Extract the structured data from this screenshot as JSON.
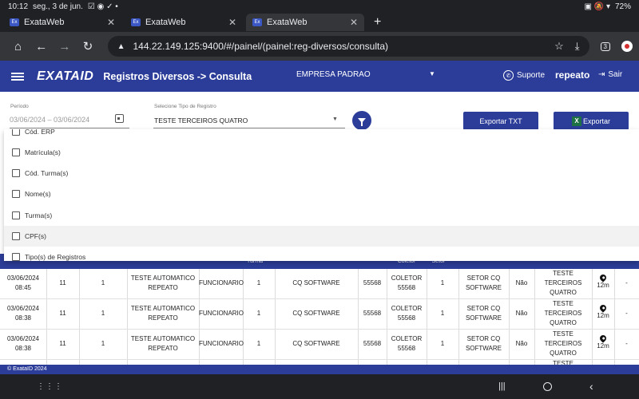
{
  "status": {
    "time": "10:12",
    "date": "seg., 3 de jun.",
    "battery": "72%"
  },
  "tabs": [
    {
      "title": "ExataWeb",
      "favicon": "Ex"
    },
    {
      "title": "ExataWeb",
      "favicon": "Ex"
    },
    {
      "title": "ExataWeb",
      "favicon": "Ex"
    }
  ],
  "browser": {
    "url": "144.22.149.125:9400/#/painel/(painel:reg-diversos/consulta)",
    "tab_count": "3"
  },
  "app": {
    "logo": "EXATA",
    "logo_suffix": "ID",
    "title": "Registros Diversos -> Consulta",
    "company": "EMPRESA PADRAO",
    "support": "Suporte",
    "user": "repeato",
    "logout": "Sair",
    "brand_color": "#2c3d99"
  },
  "filters": {
    "period_label": "Período",
    "period_value": "03/06/2024 – 03/06/2024",
    "type_label": "Selecione Tipo de Registro",
    "type_value": "TESTE TERCEIROS QUATRO",
    "export_txt": "Exportar TXT",
    "export_xls": "Exportar",
    "xls_icon_text": "X"
  },
  "dropdown": {
    "items": [
      "Cód. ERP",
      "Matrícula(s)",
      "Cód. Turma(s)",
      "Nome(s)",
      "Turma(s)",
      "CPF(s)",
      "Tipo(s) de Registros"
    ],
    "highlighted": "CPF(s)"
  },
  "table": {
    "visible_headers": [
      "Turma",
      "Coletor",
      "Setor"
    ],
    "rows": [
      {
        "date": "03/06/2024",
        "time": "08:45",
        "c1": "11",
        "c2": "1",
        "nome1": "TESTE AUTOMATICO",
        "nome2": "REPEATO",
        "tipo": "FUNCIONARIO",
        "turma": "1",
        "empresa": "CQ SOFTWARE",
        "num": "55568",
        "coletor1": "COLETOR",
        "coletor2": "55568",
        "setor": "1",
        "setor_nome1": "SETOR CQ",
        "setor_nome2": "SOFTWARE",
        "flag": "Não",
        "reg1": "TESTE",
        "reg2": "TERCEIROS",
        "reg3": "QUATRO",
        "dist": "12m",
        "extra": "-"
      },
      {
        "date": "03/06/2024",
        "time": "08:38",
        "c1": "11",
        "c2": "1",
        "nome1": "TESTE AUTOMATICO",
        "nome2": "REPEATO",
        "tipo": "FUNCIONARIO",
        "turma": "1",
        "empresa": "CQ SOFTWARE",
        "num": "55568",
        "coletor1": "COLETOR",
        "coletor2": "55568",
        "setor": "1",
        "setor_nome1": "SETOR CQ",
        "setor_nome2": "SOFTWARE",
        "flag": "Não",
        "reg1": "TESTE",
        "reg2": "TERCEIROS",
        "reg3": "QUATRO",
        "dist": "12m",
        "extra": "-"
      },
      {
        "date": "03/06/2024",
        "time": "08:38",
        "c1": "11",
        "c2": "1",
        "nome1": "TESTE AUTOMATICO",
        "nome2": "REPEATO",
        "tipo": "FUNCIONARIO",
        "turma": "1",
        "empresa": "CQ SOFTWARE",
        "num": "55568",
        "coletor1": "COLETOR",
        "coletor2": "55568",
        "setor": "1",
        "setor_nome1": "SETOR CQ",
        "setor_nome2": "SOFTWARE",
        "flag": "Não",
        "reg1": "TESTE",
        "reg2": "TERCEIROS",
        "reg3": "QUATRO",
        "dist": "12m",
        "extra": "-"
      }
    ],
    "partial_row_text": "TESTE"
  },
  "footer": {
    "text": "© ExataID 2024"
  }
}
